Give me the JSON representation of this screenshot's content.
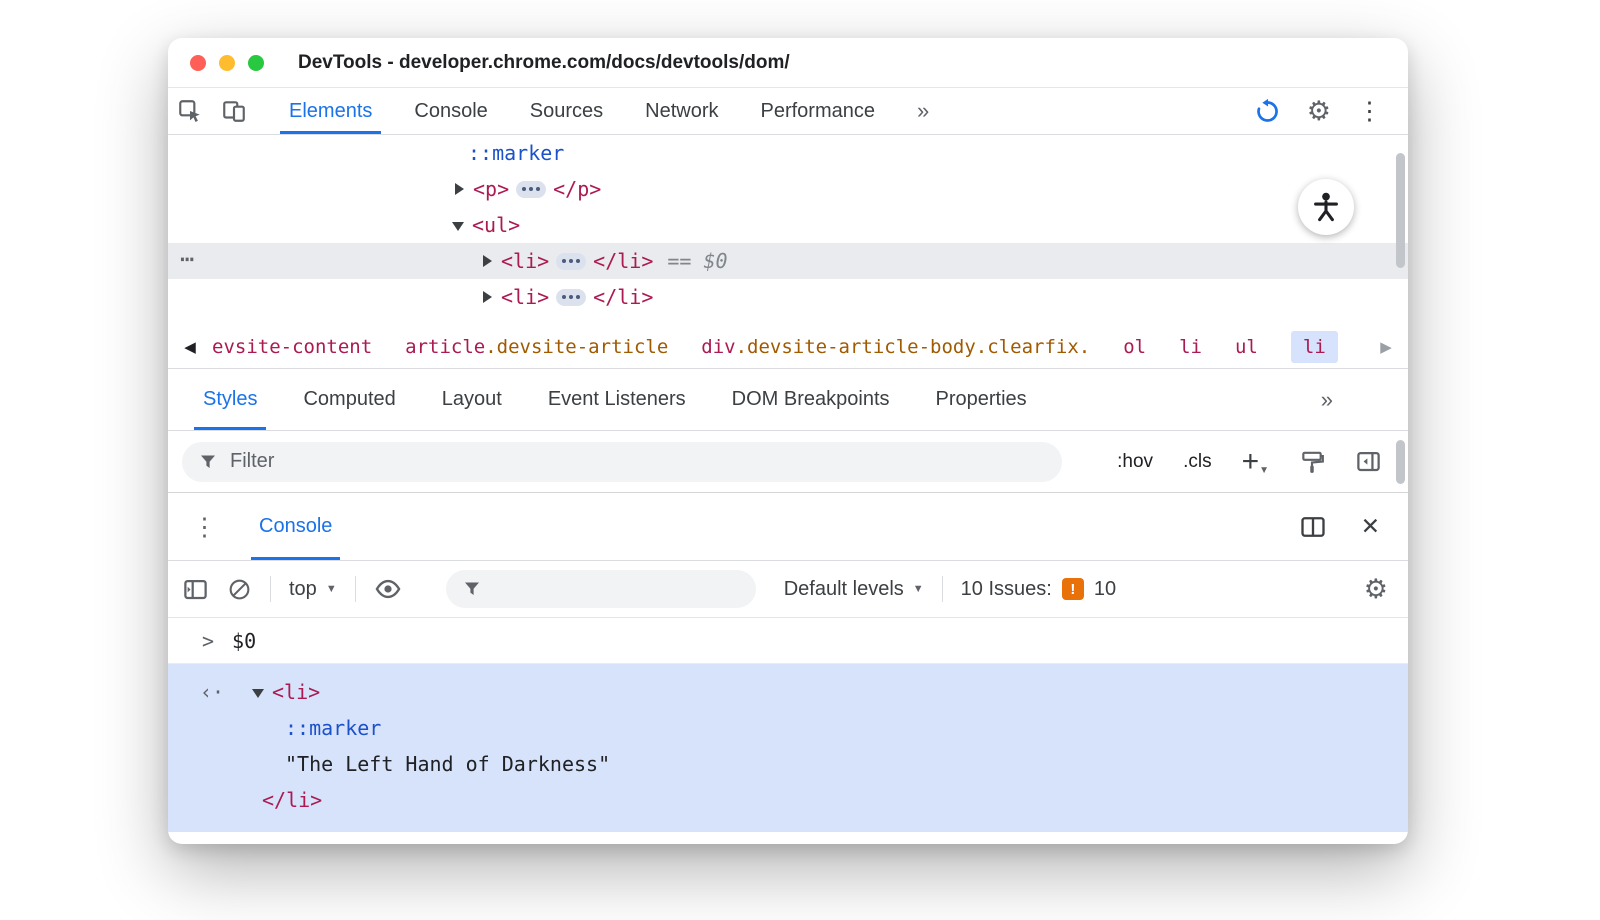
{
  "window": {
    "title": "DevTools - developer.chrome.com/docs/devtools/dom/"
  },
  "glyphs": {
    "gear": "⚙",
    "kebab": "⋮",
    "close": "✕",
    "crumb_left": "◀",
    "crumb_right": "▶",
    "caret": "▼",
    "gutter_dots": "⋯"
  },
  "toolbar": {
    "tabs": [
      {
        "label": "Elements",
        "active": true
      },
      {
        "label": "Console"
      },
      {
        "label": "Sources"
      },
      {
        "label": "Network"
      },
      {
        "label": "Performance"
      }
    ],
    "more_tabs": "»"
  },
  "dom_tree": {
    "marker_row": {
      "pseudo": "::marker"
    },
    "p_row": {
      "open": "<p>",
      "close": "</p>"
    },
    "ul_row": {
      "open": "<ul>"
    },
    "li_selected_row": {
      "gutter": "⋯",
      "open": "<li>",
      "close": "</li>",
      "equals": "==",
      "binding": "$0"
    },
    "li_row": {
      "open": "<li>",
      "close": "</li>"
    }
  },
  "breadcrumbs": {
    "items": [
      {
        "tag": "evsite-content",
        "classes": ""
      },
      {
        "tag": "article",
        "classes": ".devsite-article"
      },
      {
        "tag": "div",
        "classes": ".devsite-article-body.clearfix."
      },
      {
        "tag": "ol",
        "classes": ""
      },
      {
        "tag": "li",
        "classes": ""
      },
      {
        "tag": "ul",
        "classes": ""
      },
      {
        "tag": "li",
        "classes": "",
        "selected": true
      }
    ]
  },
  "styles_panel": {
    "tabs": [
      {
        "label": "Styles",
        "active": true
      },
      {
        "label": "Computed"
      },
      {
        "label": "Layout"
      },
      {
        "label": "Event Listeners"
      },
      {
        "label": "DOM Breakpoints"
      },
      {
        "label": "Properties"
      }
    ],
    "more_tabs": "»",
    "filter_placeholder": "Filter",
    "hov_label": ":hov",
    "cls_label": ".cls",
    "new_rule_label": "+"
  },
  "drawer": {
    "tab_label": "Console"
  },
  "console": {
    "context_selector": "top",
    "levels_selector": "Default levels",
    "issues_label": "10 Issues:",
    "issues_bang": "!",
    "issues_count": "10",
    "prompt": {
      "chevron": ">",
      "expression": "$0"
    },
    "result": {
      "marker": "‹·",
      "open": "<li>",
      "pseudo": "::marker",
      "text": "\"The Left Hand of Darkness\"",
      "close": "</li>"
    }
  },
  "colors": {
    "accent_blue": "#1a73e8",
    "tag_red": "#ab1a51",
    "class_orange": "#a05a00",
    "pseudo_blue": "#1c51c9",
    "issues_orange": "#e8710a",
    "selection_blue": "#d6e3fb",
    "inactive_selection_gray": "#e9ebee",
    "traffic_red": "#ff5f57",
    "traffic_yellow": "#febc2e",
    "traffic_green": "#28c840"
  }
}
